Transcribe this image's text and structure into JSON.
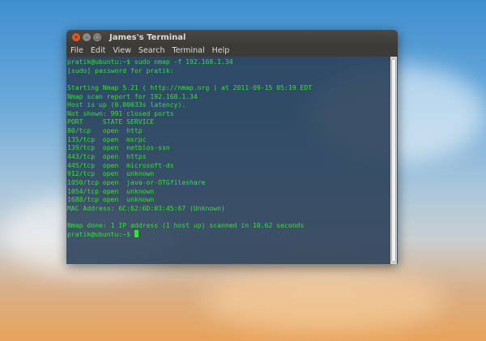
{
  "window": {
    "title": "James's Terminal"
  },
  "menu": [
    "File",
    "Edit",
    "View",
    "Search",
    "Terminal",
    "Help"
  ],
  "terminal": {
    "lines": [
      "pratik@ubuntu:~$ sudo nmap -f 192.168.1.34",
      "[sudo] password for pratik:",
      "",
      "Starting Nmap 5.21 ( http://nmap.org ) at 2011-09-15 05:19 EDT",
      "Nmap scan report for 192.168.1.34",
      "Host is up (0.00033s latency).",
      "Not shown: 991 closed ports",
      "PORT     STATE SERVICE",
      "80/tcp   open  http",
      "135/tcp  open  msrpc",
      "139/tcp  open  netbios-ssn",
      "443/tcp  open  https",
      "445/tcp  open  microsoft-ds",
      "912/tcp  open  unknown",
      "1050/tcp open  java-or-OTGfileshare",
      "1054/tcp open  unknown",
      "1688/tcp open  unknown",
      "MAC Address: 6C:62:6D:03:45:67 (Unknown)",
      "",
      "Nmap done: 1 IP address (1 host up) scanned in 10.62 seconds"
    ],
    "prompt": "pratik@ubuntu:~$ ",
    "text_color": "#35e135"
  }
}
